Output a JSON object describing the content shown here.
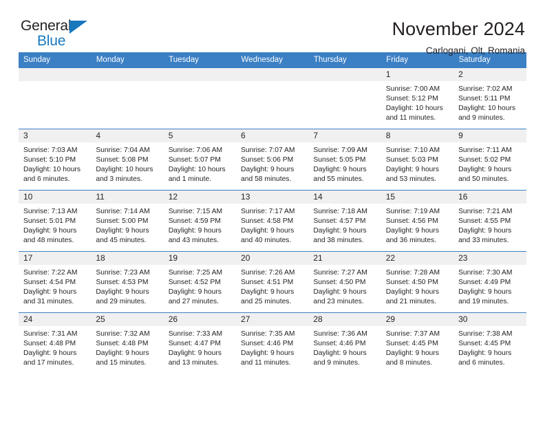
{
  "brand": {
    "name_part1": "General",
    "name_part2": "Blue",
    "triangle_color": "#1878be"
  },
  "header": {
    "month_title": "November 2024",
    "location": "Carlogani, Olt, Romania"
  },
  "theme": {
    "header_blue": "#3b7fc4",
    "daynum_band": "#f0f0f0",
    "text": "#231f20"
  },
  "weekday_headers": [
    "Sunday",
    "Monday",
    "Tuesday",
    "Wednesday",
    "Thursday",
    "Friday",
    "Saturday"
  ],
  "weeks": [
    [
      {
        "day": "",
        "sunrise": "",
        "sunset": "",
        "daylight": "",
        "empty": true
      },
      {
        "day": "",
        "sunrise": "",
        "sunset": "",
        "daylight": "",
        "empty": true
      },
      {
        "day": "",
        "sunrise": "",
        "sunset": "",
        "daylight": "",
        "empty": true
      },
      {
        "day": "",
        "sunrise": "",
        "sunset": "",
        "daylight": "",
        "empty": true
      },
      {
        "day": "",
        "sunrise": "",
        "sunset": "",
        "daylight": "",
        "empty": true
      },
      {
        "day": "1",
        "sunrise": "Sunrise: 7:00 AM",
        "sunset": "Sunset: 5:12 PM",
        "daylight": "Daylight: 10 hours and 11 minutes.",
        "empty": false
      },
      {
        "day": "2",
        "sunrise": "Sunrise: 7:02 AM",
        "sunset": "Sunset: 5:11 PM",
        "daylight": "Daylight: 10 hours and 9 minutes.",
        "empty": false
      }
    ],
    [
      {
        "day": "3",
        "sunrise": "Sunrise: 7:03 AM",
        "sunset": "Sunset: 5:10 PM",
        "daylight": "Daylight: 10 hours and 6 minutes.",
        "empty": false
      },
      {
        "day": "4",
        "sunrise": "Sunrise: 7:04 AM",
        "sunset": "Sunset: 5:08 PM",
        "daylight": "Daylight: 10 hours and 3 minutes.",
        "empty": false
      },
      {
        "day": "5",
        "sunrise": "Sunrise: 7:06 AM",
        "sunset": "Sunset: 5:07 PM",
        "daylight": "Daylight: 10 hours and 1 minute.",
        "empty": false
      },
      {
        "day": "6",
        "sunrise": "Sunrise: 7:07 AM",
        "sunset": "Sunset: 5:06 PM",
        "daylight": "Daylight: 9 hours and 58 minutes.",
        "empty": false
      },
      {
        "day": "7",
        "sunrise": "Sunrise: 7:09 AM",
        "sunset": "Sunset: 5:05 PM",
        "daylight": "Daylight: 9 hours and 55 minutes.",
        "empty": false
      },
      {
        "day": "8",
        "sunrise": "Sunrise: 7:10 AM",
        "sunset": "Sunset: 5:03 PM",
        "daylight": "Daylight: 9 hours and 53 minutes.",
        "empty": false
      },
      {
        "day": "9",
        "sunrise": "Sunrise: 7:11 AM",
        "sunset": "Sunset: 5:02 PM",
        "daylight": "Daylight: 9 hours and 50 minutes.",
        "empty": false
      }
    ],
    [
      {
        "day": "10",
        "sunrise": "Sunrise: 7:13 AM",
        "sunset": "Sunset: 5:01 PM",
        "daylight": "Daylight: 9 hours and 48 minutes.",
        "empty": false
      },
      {
        "day": "11",
        "sunrise": "Sunrise: 7:14 AM",
        "sunset": "Sunset: 5:00 PM",
        "daylight": "Daylight: 9 hours and 45 minutes.",
        "empty": false
      },
      {
        "day": "12",
        "sunrise": "Sunrise: 7:15 AM",
        "sunset": "Sunset: 4:59 PM",
        "daylight": "Daylight: 9 hours and 43 minutes.",
        "empty": false
      },
      {
        "day": "13",
        "sunrise": "Sunrise: 7:17 AM",
        "sunset": "Sunset: 4:58 PM",
        "daylight": "Daylight: 9 hours and 40 minutes.",
        "empty": false
      },
      {
        "day": "14",
        "sunrise": "Sunrise: 7:18 AM",
        "sunset": "Sunset: 4:57 PM",
        "daylight": "Daylight: 9 hours and 38 minutes.",
        "empty": false
      },
      {
        "day": "15",
        "sunrise": "Sunrise: 7:19 AM",
        "sunset": "Sunset: 4:56 PM",
        "daylight": "Daylight: 9 hours and 36 minutes.",
        "empty": false
      },
      {
        "day": "16",
        "sunrise": "Sunrise: 7:21 AM",
        "sunset": "Sunset: 4:55 PM",
        "daylight": "Daylight: 9 hours and 33 minutes.",
        "empty": false
      }
    ],
    [
      {
        "day": "17",
        "sunrise": "Sunrise: 7:22 AM",
        "sunset": "Sunset: 4:54 PM",
        "daylight": "Daylight: 9 hours and 31 minutes.",
        "empty": false
      },
      {
        "day": "18",
        "sunrise": "Sunrise: 7:23 AM",
        "sunset": "Sunset: 4:53 PM",
        "daylight": "Daylight: 9 hours and 29 minutes.",
        "empty": false
      },
      {
        "day": "19",
        "sunrise": "Sunrise: 7:25 AM",
        "sunset": "Sunset: 4:52 PM",
        "daylight": "Daylight: 9 hours and 27 minutes.",
        "empty": false
      },
      {
        "day": "20",
        "sunrise": "Sunrise: 7:26 AM",
        "sunset": "Sunset: 4:51 PM",
        "daylight": "Daylight: 9 hours and 25 minutes.",
        "empty": false
      },
      {
        "day": "21",
        "sunrise": "Sunrise: 7:27 AM",
        "sunset": "Sunset: 4:50 PM",
        "daylight": "Daylight: 9 hours and 23 minutes.",
        "empty": false
      },
      {
        "day": "22",
        "sunrise": "Sunrise: 7:28 AM",
        "sunset": "Sunset: 4:50 PM",
        "daylight": "Daylight: 9 hours and 21 minutes.",
        "empty": false
      },
      {
        "day": "23",
        "sunrise": "Sunrise: 7:30 AM",
        "sunset": "Sunset: 4:49 PM",
        "daylight": "Daylight: 9 hours and 19 minutes.",
        "empty": false
      }
    ],
    [
      {
        "day": "24",
        "sunrise": "Sunrise: 7:31 AM",
        "sunset": "Sunset: 4:48 PM",
        "daylight": "Daylight: 9 hours and 17 minutes.",
        "empty": false
      },
      {
        "day": "25",
        "sunrise": "Sunrise: 7:32 AM",
        "sunset": "Sunset: 4:48 PM",
        "daylight": "Daylight: 9 hours and 15 minutes.",
        "empty": false
      },
      {
        "day": "26",
        "sunrise": "Sunrise: 7:33 AM",
        "sunset": "Sunset: 4:47 PM",
        "daylight": "Daylight: 9 hours and 13 minutes.",
        "empty": false
      },
      {
        "day": "27",
        "sunrise": "Sunrise: 7:35 AM",
        "sunset": "Sunset: 4:46 PM",
        "daylight": "Daylight: 9 hours and 11 minutes.",
        "empty": false
      },
      {
        "day": "28",
        "sunrise": "Sunrise: 7:36 AM",
        "sunset": "Sunset: 4:46 PM",
        "daylight": "Daylight: 9 hours and 9 minutes.",
        "empty": false
      },
      {
        "day": "29",
        "sunrise": "Sunrise: 7:37 AM",
        "sunset": "Sunset: 4:45 PM",
        "daylight": "Daylight: 9 hours and 8 minutes.",
        "empty": false
      },
      {
        "day": "30",
        "sunrise": "Sunrise: 7:38 AM",
        "sunset": "Sunset: 4:45 PM",
        "daylight": "Daylight: 9 hours and 6 minutes.",
        "empty": false
      }
    ]
  ]
}
